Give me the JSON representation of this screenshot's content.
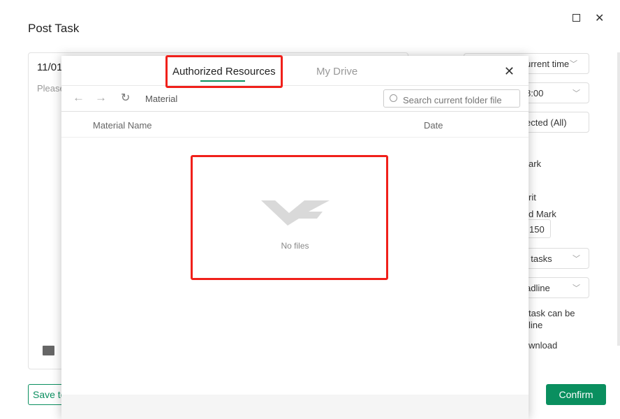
{
  "dialog": {
    "title": "Post Task",
    "editor_date": "11/01",
    "editor_placeholder": "Please",
    "save_label": "Save to",
    "confirm_label": "Confirm"
  },
  "right_fields": [
    "urrent time",
    "8:00",
    "ected (All)",
    "t tasks",
    "adline"
  ],
  "right_texts": [
    "ark",
    "rit",
    "d Mark",
    "150",
    "task can be",
    "line",
    "wnload"
  ],
  "modal": {
    "tabs": [
      {
        "label": "Authorized Resources",
        "active": true
      },
      {
        "label": "My Drive",
        "active": false
      }
    ],
    "breadcrumb": "Material",
    "search_placeholder": "Search current folder file",
    "columns": [
      "Material Name",
      "Date"
    ],
    "empty_text": "No files"
  },
  "colors": {
    "accent": "#0a8f5f",
    "highlight": "#f0201a"
  }
}
